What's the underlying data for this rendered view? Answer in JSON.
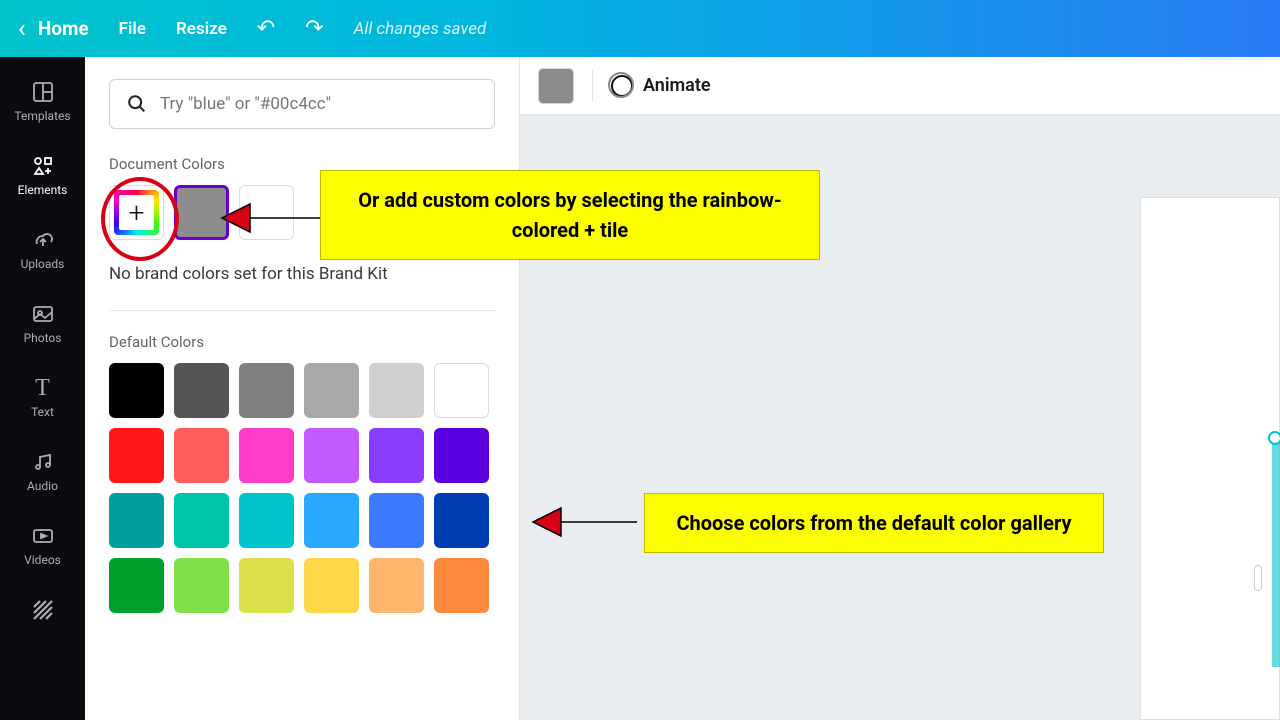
{
  "topbar": {
    "home": "Home",
    "file": "File",
    "resize": "Resize",
    "status": "All changes saved"
  },
  "sidenav": {
    "templates": "Templates",
    "elements": "Elements",
    "uploads": "Uploads",
    "photos": "Photos",
    "text": "Text",
    "audio": "Audio",
    "videos": "Videos"
  },
  "panel": {
    "search_placeholder": "Try \"blue\" or \"#00c4cc\"",
    "document_colors_label": "Document Colors",
    "brand_msg": "No brand colors set for this Brand Kit",
    "default_label": "Default Colors"
  },
  "default_colors": [
    "#000000",
    "#555555",
    "#808080",
    "#a8a8a8",
    "#cfcfcf",
    "#ffffff",
    "#ff1616",
    "#ff5c5c",
    "#ff3cc7",
    "#c05cff",
    "#8a3cff",
    "#5a00e0",
    "#009e9e",
    "#00c4a8",
    "#00c4cc",
    "#2aa8ff",
    "#3c7bff",
    "#003db3",
    "#009e2d",
    "#7fe04a",
    "#d9e04a",
    "#ffd84a",
    "#ffb56b",
    "#ff8a3d"
  ],
  "canvas": {
    "animate": "Animate"
  },
  "annotations": {
    "callout1": "Or add custom colors by selecting the rainbow-colored + tile",
    "callout2": "Choose colors from the default color gallery"
  }
}
